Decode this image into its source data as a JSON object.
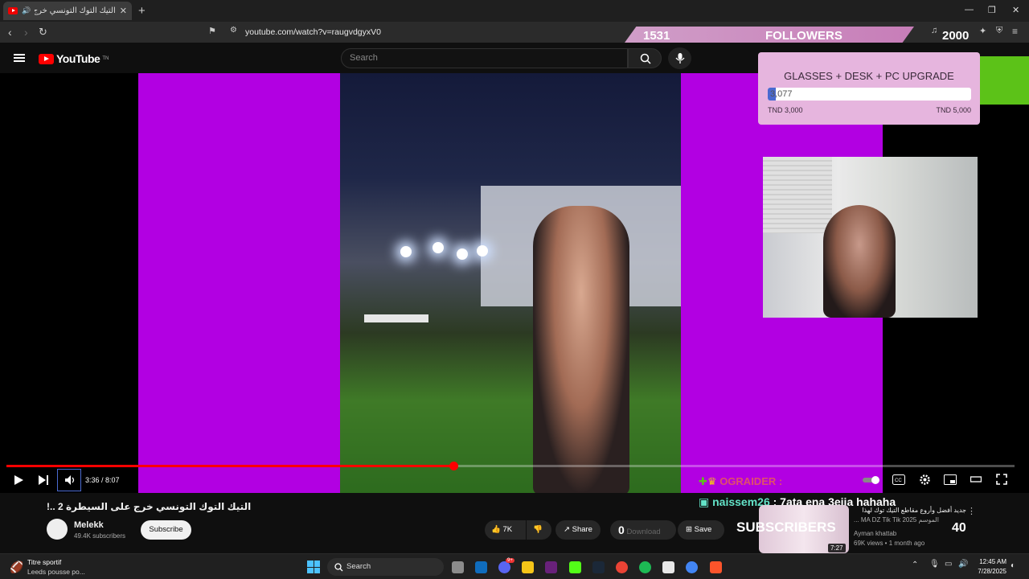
{
  "browser": {
    "tab_title": "التيك التوك التونسي خرج على ...",
    "tab_close": "✕",
    "new_tab": "+",
    "url": "youtube.com/watch?v=raugvdgyxV0",
    "window_controls": [
      "—",
      "❐",
      "✕"
    ]
  },
  "youtube": {
    "logo_text": "YouTube",
    "logo_sup": "TN",
    "search_placeholder": "Search"
  },
  "player": {
    "time_current": "3:36",
    "time_total": "8:07",
    "time_display": "3:36 / 8:07",
    "progress_fraction": 0.443
  },
  "overlay": {
    "followers_count": "1531",
    "followers_label": "FOLLOWERS",
    "followers_goal": "2000",
    "donation_title": "GLASSES + DESK + PC UPGRADE",
    "donation_value": "3,077",
    "donation_min": "TND 3,000",
    "donation_max": "TND 5,000",
    "donation_fraction": 0.04,
    "chat_line1_user": "OGRAIDER :",
    "chat_line2_user": "naissem26",
    "chat_line2_text": " : 7ata ena 3ejja hahaha",
    "subscribers_label": "SUBSCRIBERS",
    "subscribers_count": "40",
    "accent_pink": "#e6b5de",
    "accent_purple": "#b200e2"
  },
  "video_info": {
    "title": "التيك التوك التونسي خرج على السيطرة 2 ..!",
    "channel": "Melekk",
    "subscribers": "49.4K subscribers",
    "subscribe_label": "Subscribe",
    "likes": "7K",
    "share_label": "Share",
    "download_label": "Download",
    "save_label": "Save",
    "download_count": "0"
  },
  "recommended": {
    "title": "جديد أفضل وأروع مقاطع التيك توك لهذا",
    "subtitle": "الموسم MA DZ Tik Tik 2025 ...",
    "channel": "Ayman khattab",
    "meta": "69K views • 1 month ago",
    "duration": "7:27"
  },
  "taskbar": {
    "widget_title": "Titre sportif",
    "widget_subtitle": "Leeds pousse po...",
    "search_label": "Search",
    "time": "12:45 AM",
    "date": "7/28/2025",
    "badge_notifications": "9+"
  }
}
